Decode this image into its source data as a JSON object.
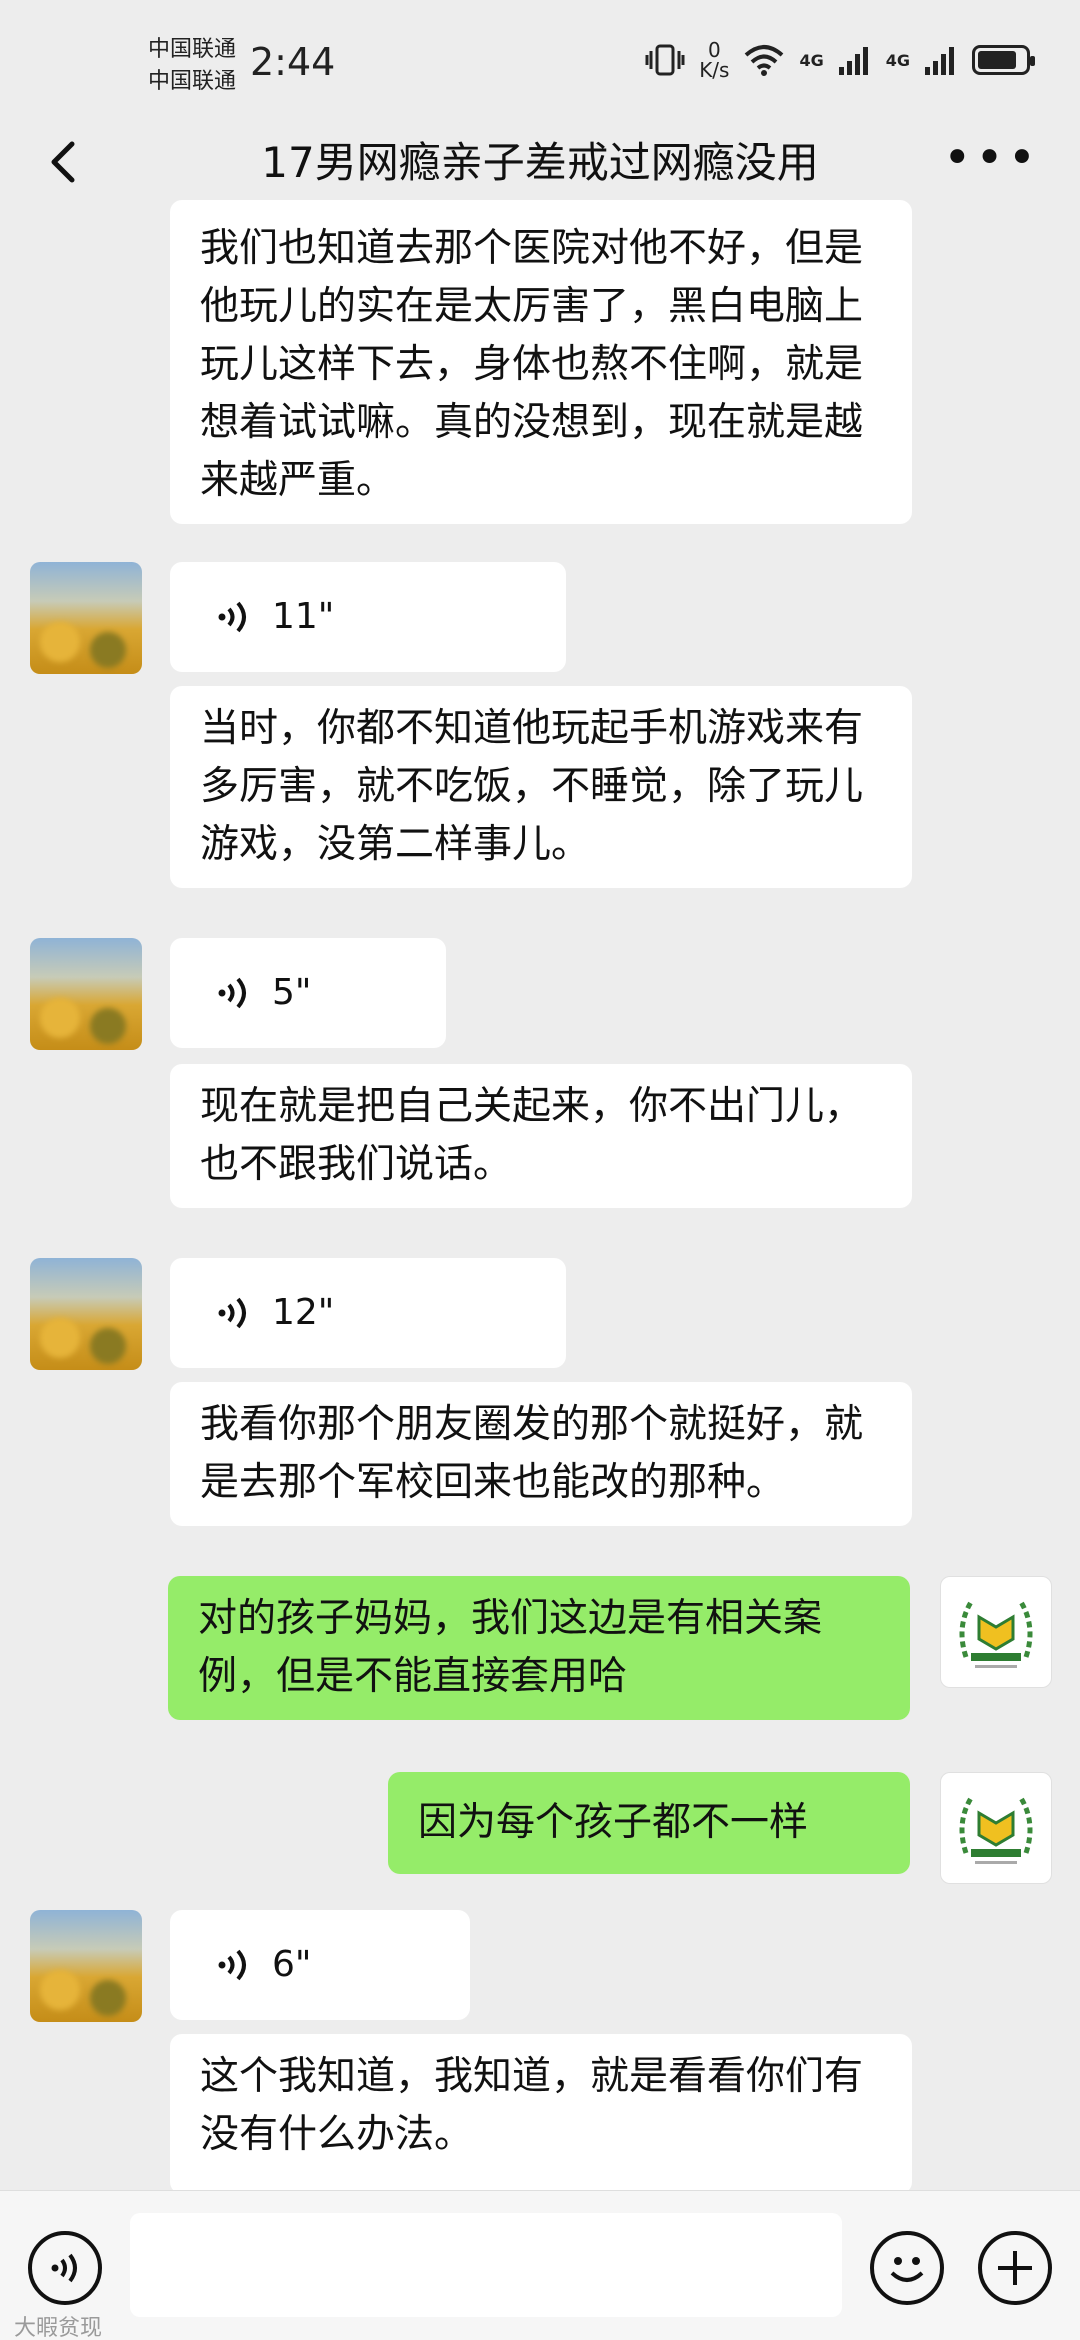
{
  "status_bar": {
    "carrier_1": "中国联通",
    "carrier_2": "中国联通",
    "time": "2:44",
    "net_speed_value": "0",
    "net_speed_unit": "K/s",
    "net_1": "4G",
    "net_2": "4G"
  },
  "header": {
    "title": "17男网瘾亲子差戒过网瘾没用"
  },
  "messages": [
    {
      "text": "我们也知道去那个医院对他不好，但是他玩儿的实在是太厉害了，黑白电脑上玩儿这样下去，身体也熬不住啊，就是想着试试嘛。真的没想到，现在就是越来越严重。"
    },
    {
      "voice": "11\""
    },
    {
      "text": "当时，你都不知道他玩起手机游戏来有多厉害，就不吃饭，不睡觉，除了玩儿游戏，没第二样事儿。"
    },
    {
      "voice": "5\""
    },
    {
      "text": "现在就是把自己关起来，你不出门儿，也不跟我们说话。"
    },
    {
      "voice": "12\""
    },
    {
      "text": "我看你那个朋友圈发的那个就挺好，就是去那个军校回来也能改的那种。"
    },
    {
      "text": "对的孩子妈妈，我们这边是有相关案例，但是不能直接套用哈"
    },
    {
      "text": "因为每个孩子都不一样"
    },
    {
      "voice": "6\""
    },
    {
      "text": "这个我知道，我知道，就是看看你们有没有什么办法。"
    }
  ],
  "watermark": "大暇贫现",
  "colors": {
    "background": "#ededed",
    "bubble_received": "#ffffff",
    "bubble_sent": "#95ec69"
  }
}
